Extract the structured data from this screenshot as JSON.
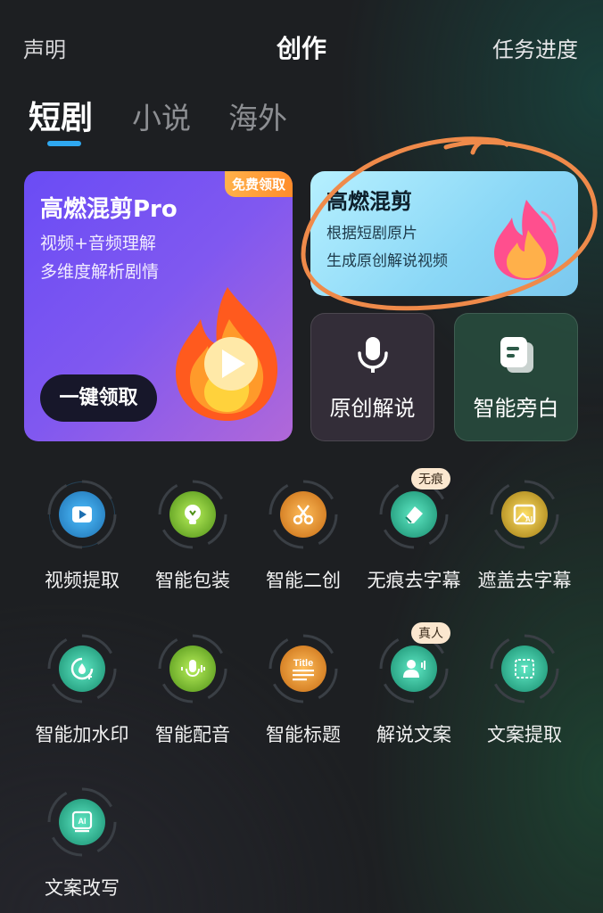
{
  "header": {
    "left_label": "声明",
    "title": "创作",
    "right_label": "任务进度"
  },
  "tabs": [
    {
      "label": "短剧",
      "active": true
    },
    {
      "label": "小说",
      "active": false
    },
    {
      "label": "海外",
      "active": false
    }
  ],
  "promo_pro": {
    "badge": "免费领取",
    "title": "高燃混剪Pro",
    "line1": "视频+音频理解",
    "line2": "多维度解析剧情",
    "button": "一键领取"
  },
  "promo_blue": {
    "title": "高燃混剪",
    "line1": "根据短剧原片",
    "line2": "生成原创解说视频"
  },
  "quick_cards": [
    {
      "label": "原创解说",
      "icon": "microphone-icon"
    },
    {
      "label": "智能旁白",
      "icon": "document-icon"
    }
  ],
  "tools": [
    {
      "label": "视频提取",
      "icon": "video-icon",
      "color": "#3aa7f0"
    },
    {
      "label": "智能包装",
      "icon": "lightbulb-icon",
      "color": "#8fd43a"
    },
    {
      "label": "智能二创",
      "icon": "scissors-icon",
      "color": "#f2a23a"
    },
    {
      "label": "无痕去字幕",
      "icon": "eraser-icon",
      "color": "#2fd6b0",
      "tag": "无痕"
    },
    {
      "label": "遮盖去字幕",
      "icon": "ai-image-icon",
      "color": "#e8c23a"
    },
    {
      "label": "智能加水印",
      "icon": "watermark-icon",
      "color": "#2fd6b0"
    },
    {
      "label": "智能配音",
      "icon": "voice-icon",
      "color": "#8fd43a"
    },
    {
      "label": "智能标题",
      "icon": "title-icon",
      "color": "#f2a23a",
      "icon_text": "Title"
    },
    {
      "label": "解说文案",
      "icon": "person-voice-icon",
      "color": "#2fd6b0",
      "tag": "真人"
    },
    {
      "label": "文案提取",
      "icon": "text-extract-icon",
      "color": "#2fd6b0",
      "icon_text": "T"
    },
    {
      "label": "文案改写",
      "icon": "ai-rewrite-icon",
      "color": "#2fd6b0",
      "icon_text": "AI"
    }
  ]
}
